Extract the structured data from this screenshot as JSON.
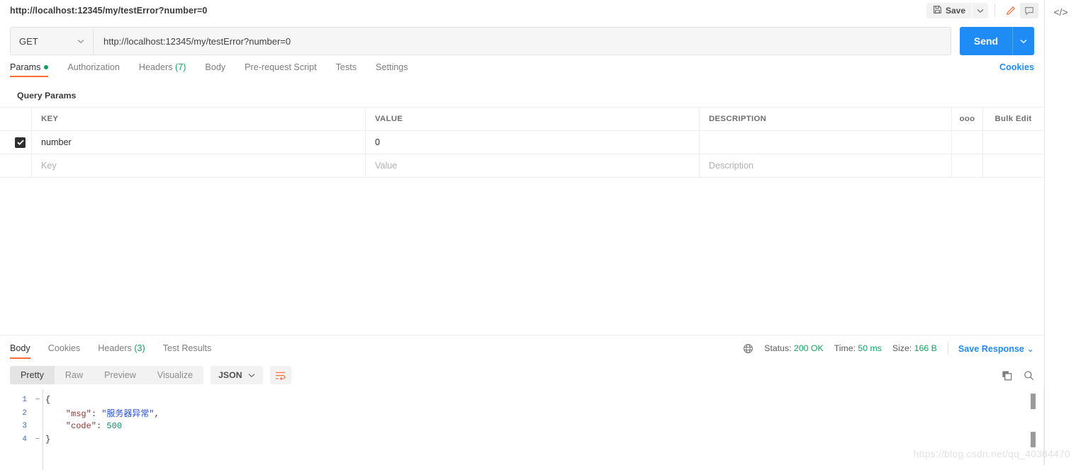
{
  "titlebar": {
    "tab_title": "http://localhost:12345/my/testError?number=0",
    "save_label": "Save",
    "save_caret": "⌄",
    "edit_icon": "pencil-icon",
    "comment_icon": "comment-icon",
    "code_icon": "</>"
  },
  "request": {
    "method": "GET",
    "method_caret": "⌄",
    "url": "http://localhost:12345/my/testError?number=0",
    "send_label": "Send",
    "send_caret": "⌄"
  },
  "request_tabs": {
    "items": [
      {
        "label": "Params",
        "active": true,
        "dot": true
      },
      {
        "label": "Authorization",
        "active": false
      },
      {
        "label": "Headers",
        "active": false,
        "count": "(7)"
      },
      {
        "label": "Body",
        "active": false
      },
      {
        "label": "Pre-request Script",
        "active": false
      },
      {
        "label": "Tests",
        "active": false
      },
      {
        "label": "Settings",
        "active": false
      }
    ],
    "cookies_link": "Cookies"
  },
  "query_params": {
    "section_title": "Query Params",
    "columns": [
      "KEY",
      "VALUE",
      "DESCRIPTION"
    ],
    "more_icon": "ooo",
    "bulk_edit_label": "Bulk Edit",
    "rows": [
      {
        "checked": true,
        "key": "number",
        "value": "0",
        "description": ""
      }
    ],
    "new_row": {
      "key_placeholder": "Key",
      "value_placeholder": "Value",
      "description_placeholder": "Description"
    }
  },
  "response": {
    "tabs": [
      {
        "label": "Body",
        "active": true
      },
      {
        "label": "Cookies",
        "active": false
      },
      {
        "label": "Headers",
        "active": false,
        "count": "(3)"
      },
      {
        "label": "Test Results",
        "active": false
      }
    ],
    "globe_icon": "globe-icon",
    "status_label": "Status:",
    "status_value": "200 OK",
    "time_label": "Time:",
    "time_value": "50 ms",
    "size_label": "Size:",
    "size_value": "166 B",
    "save_response_label": "Save Response",
    "save_response_caret": "⌄",
    "view_modes": [
      {
        "label": "Pretty",
        "active": true
      },
      {
        "label": "Raw",
        "active": false
      },
      {
        "label": "Preview",
        "active": false
      },
      {
        "label": "Visualize",
        "active": false
      }
    ],
    "format_value": "JSON",
    "format_caret": "⌄",
    "wrap_icon": "word-wrap-icon",
    "copy_icon": "copy-icon",
    "search_icon": "search-icon",
    "body_lines": [
      {
        "no": "1",
        "fold": "−",
        "segments": [
          {
            "t": "{",
            "c": "k-pun"
          }
        ]
      },
      {
        "no": "2",
        "fold": "",
        "segments": [
          {
            "t": "    \"msg\"",
            "c": "k-key"
          },
          {
            "t": ": ",
            "c": "k-pun"
          },
          {
            "t": "\"服务器异常\"",
            "c": "k-str"
          },
          {
            "t": ",",
            "c": "k-pun"
          }
        ]
      },
      {
        "no": "3",
        "fold": "",
        "segments": [
          {
            "t": "    \"code\"",
            "c": "k-key"
          },
          {
            "t": ": ",
            "c": "k-pun"
          },
          {
            "t": "500",
            "c": "k-num"
          }
        ]
      },
      {
        "no": "4",
        "fold": "−",
        "segments": [
          {
            "t": "}",
            "c": "k-pun"
          }
        ]
      }
    ]
  },
  "watermark": "https://blog.csdn.net/qq_40384470",
  "colors": {
    "accent_orange": "#ff6c37",
    "send_blue": "#1f8bf5",
    "status_green": "#15a15e",
    "link_blue": "#1f8bf5"
  }
}
